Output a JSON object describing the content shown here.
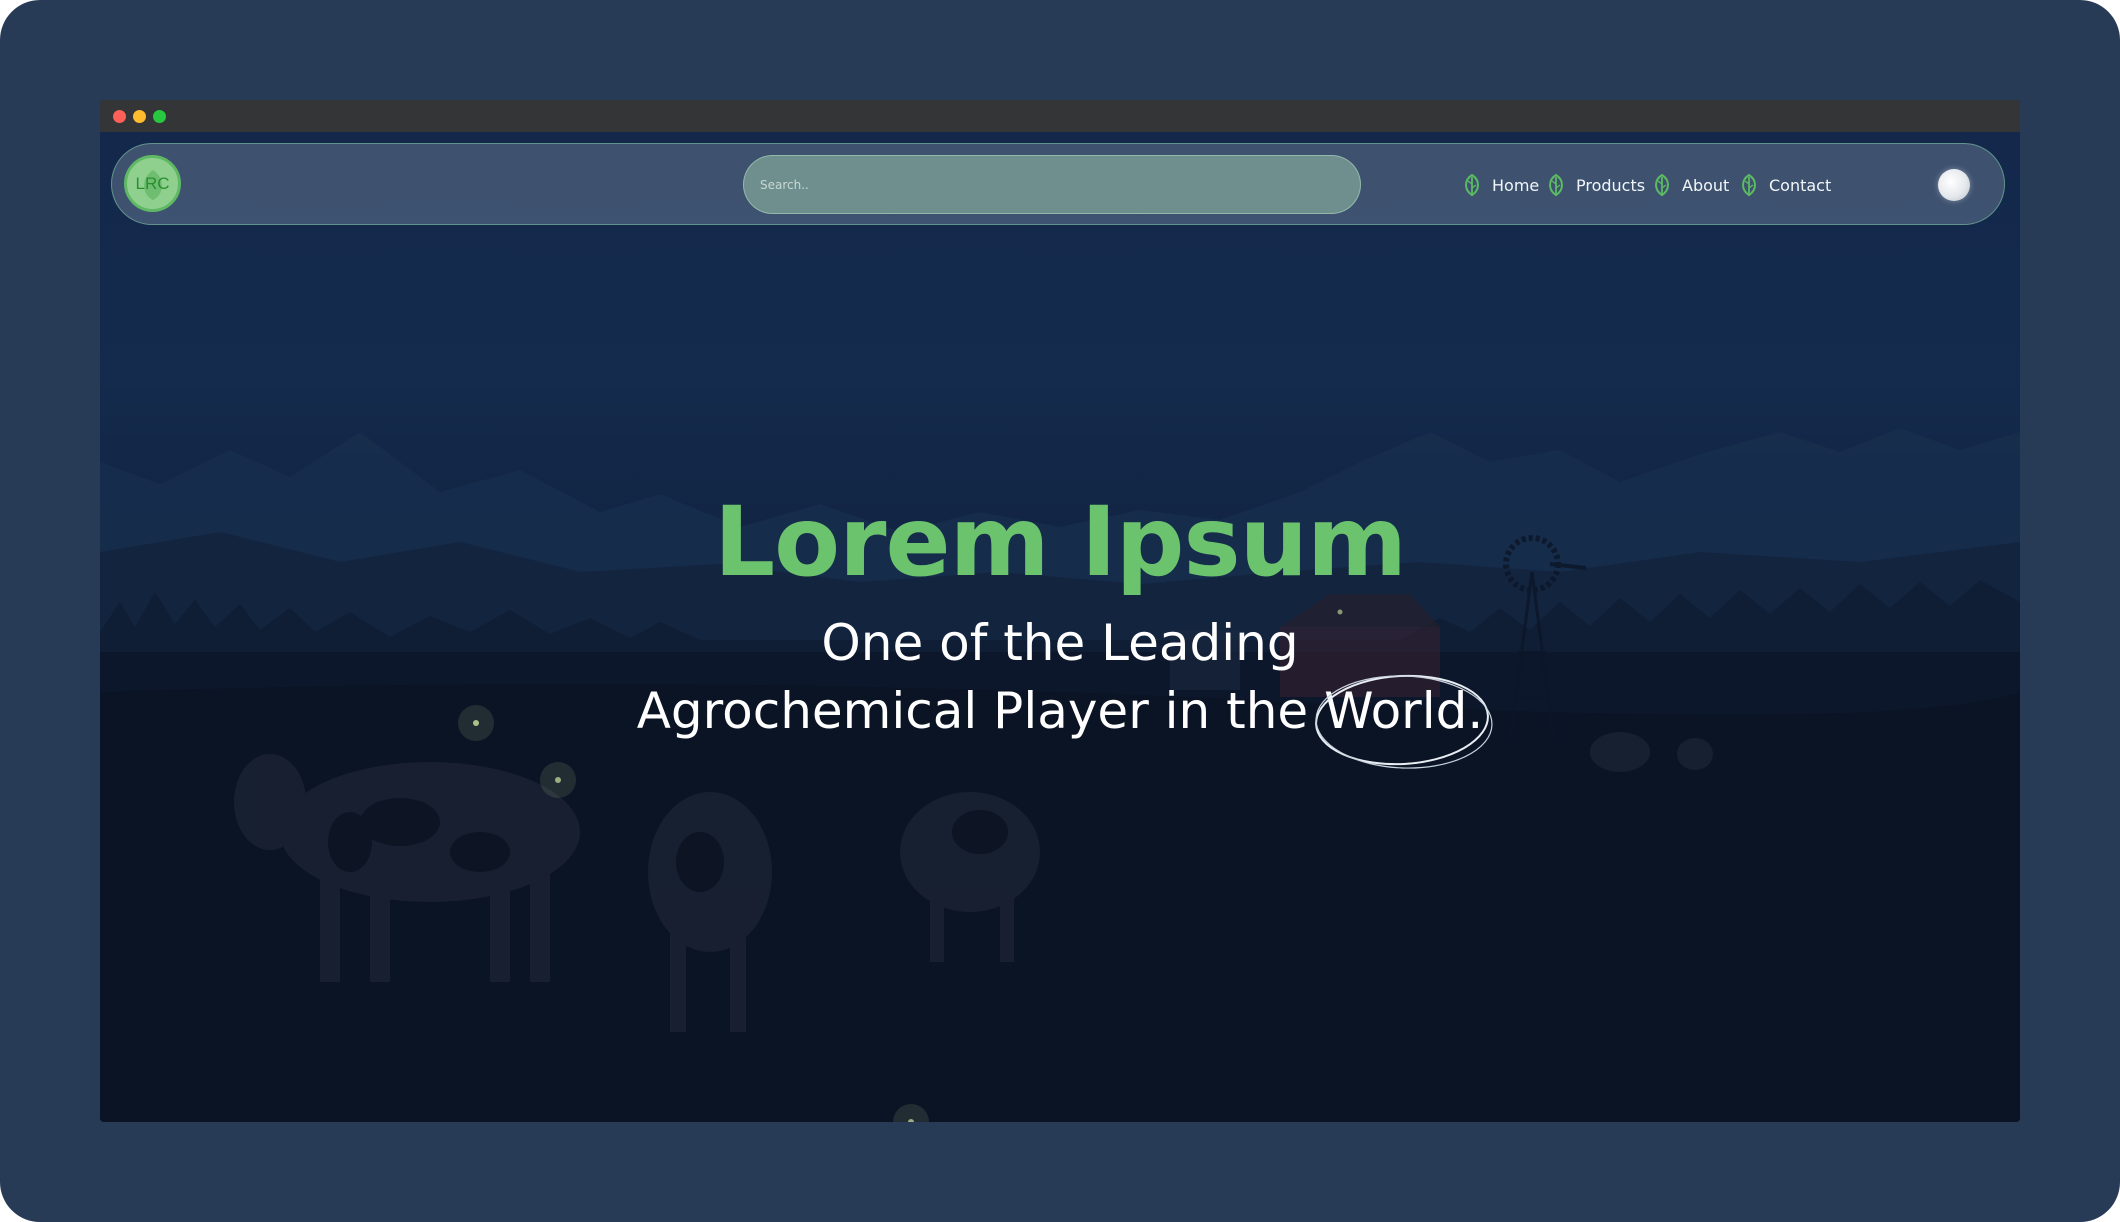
{
  "browser": {
    "buttons": [
      "close",
      "minimize",
      "maximize"
    ]
  },
  "navbar": {
    "logo_text": "LRC",
    "search_placeholder": "Search..",
    "items": [
      {
        "label": "Home",
        "icon": "leaf-icon"
      },
      {
        "label": "Products",
        "icon": "leaf-icon"
      },
      {
        "label": "About",
        "icon": "leaf-icon"
      },
      {
        "label": "Contact",
        "icon": "leaf-icon"
      }
    ],
    "theme_toggle_icon": "moon-toggle-icon"
  },
  "hero": {
    "title": "Lorem Ipsum",
    "subtitle_line1": "One of the Leading",
    "subtitle_line2_prefix": "Agrochemical Player in the ",
    "subtitle_highlight": "World."
  },
  "colors": {
    "accent_green": "#6cc36e",
    "background_navy": "#13284b",
    "frame": "#283b56"
  }
}
